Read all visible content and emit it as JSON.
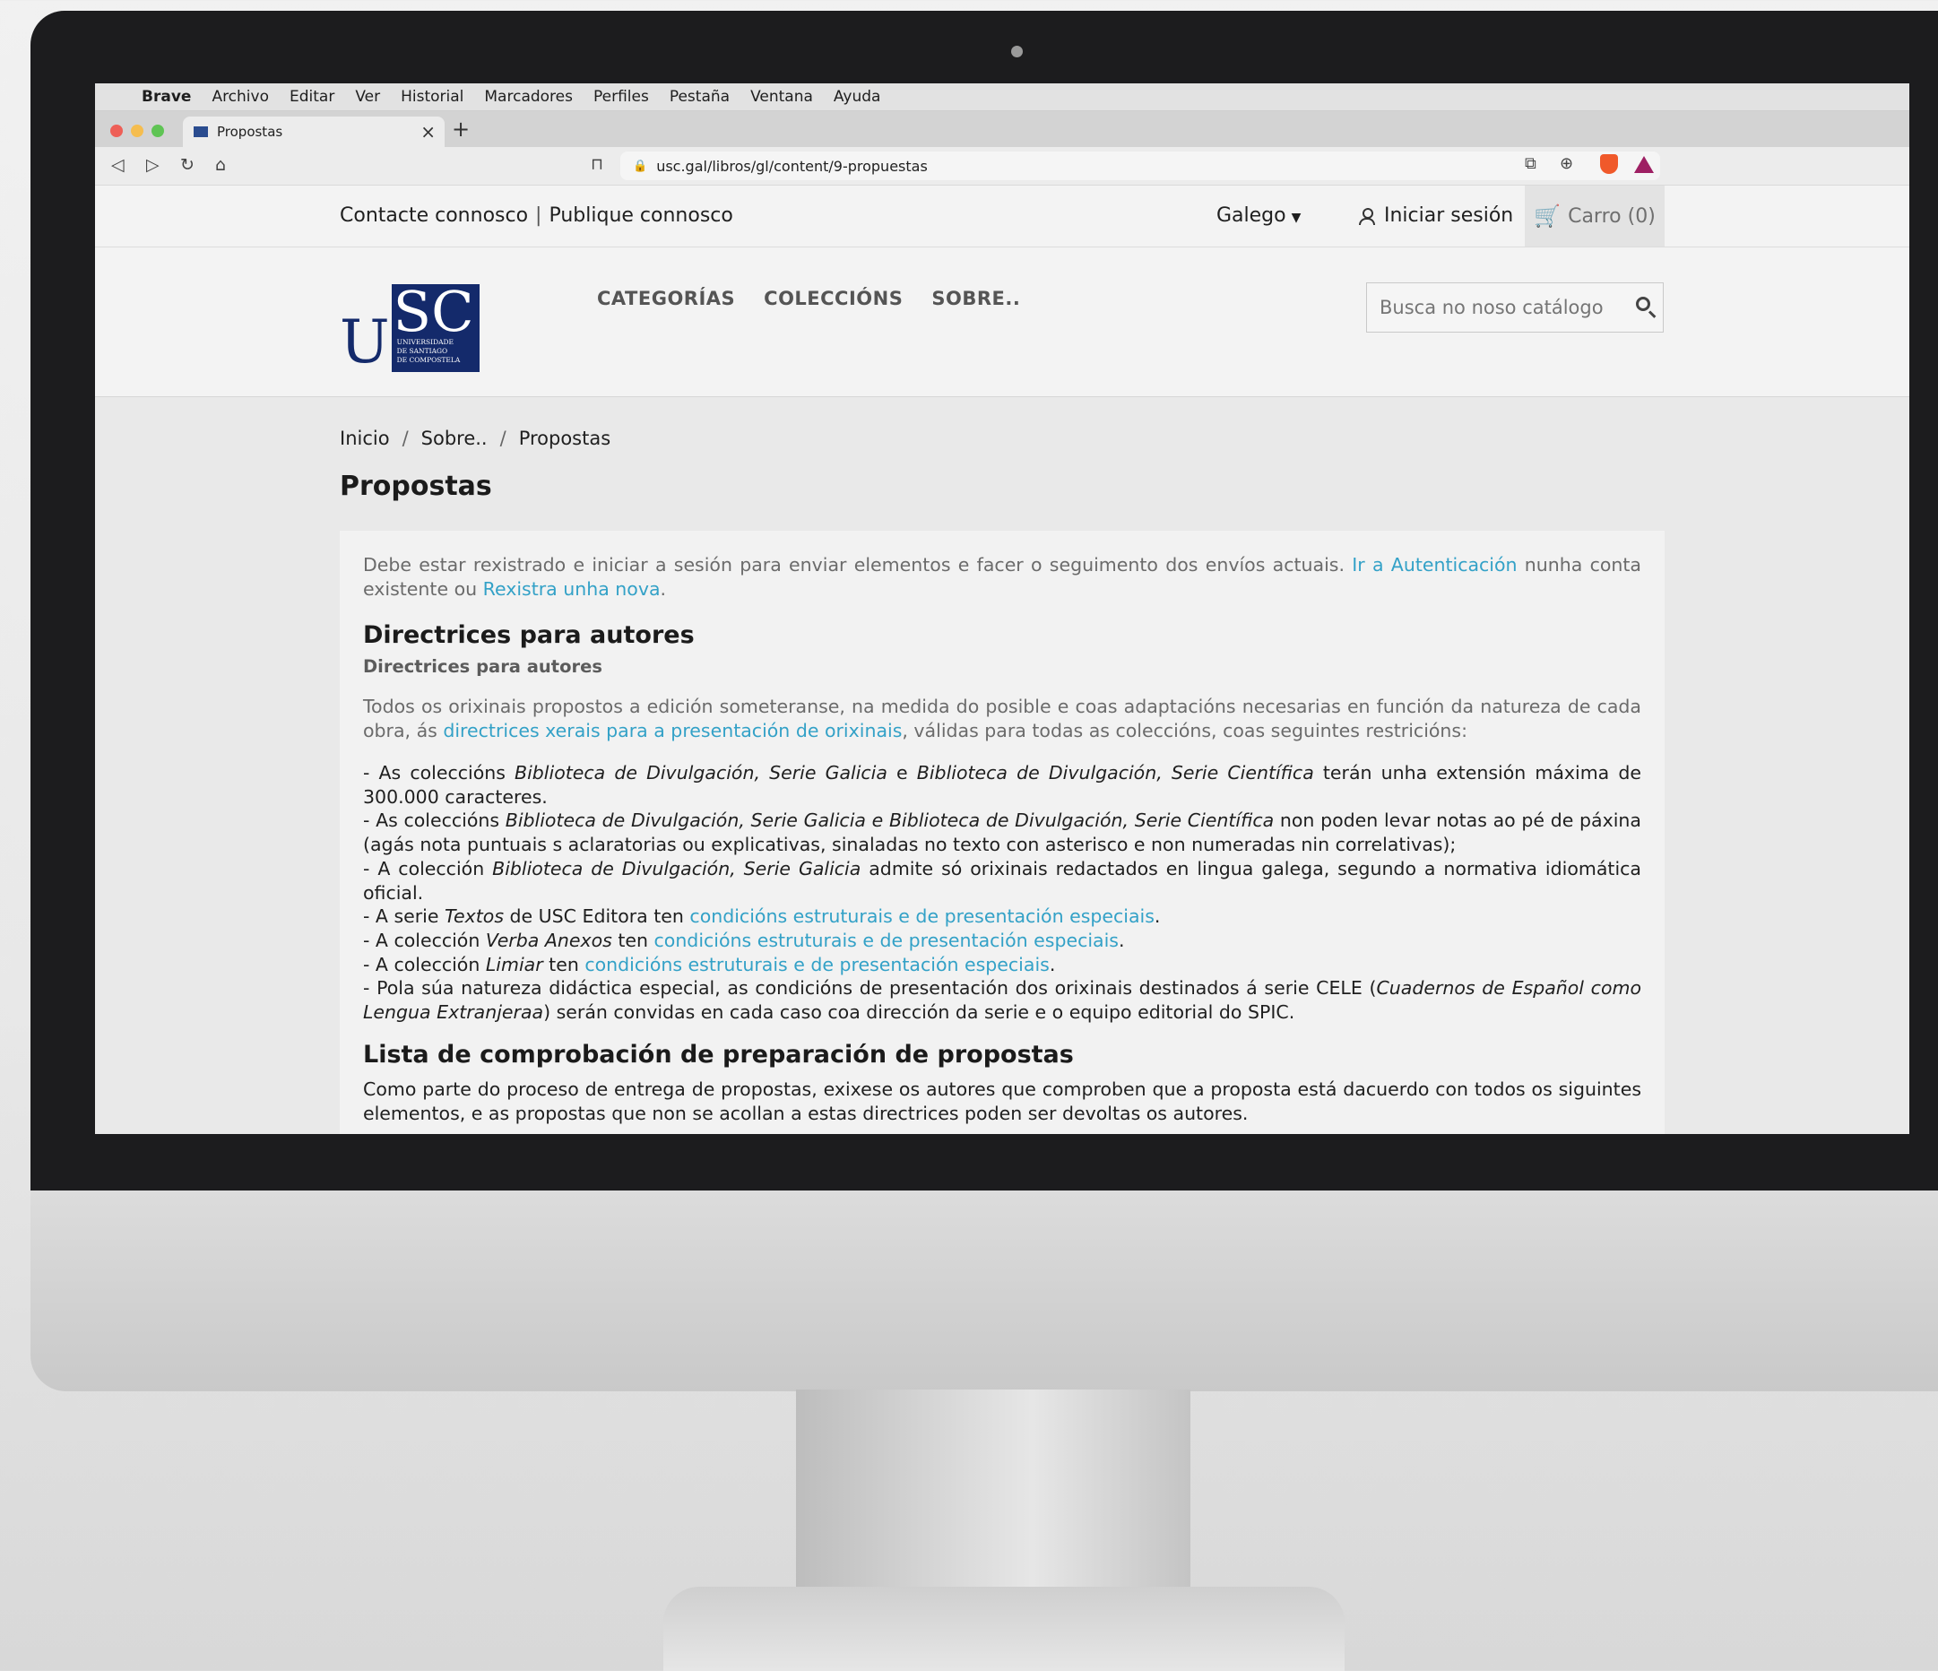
{
  "menubar": {
    "app": "Brave",
    "items": [
      "Archivo",
      "Editar",
      "Ver",
      "Historial",
      "Marcadores",
      "Perfiles",
      "Pestaña",
      "Ventana",
      "Ayuda"
    ]
  },
  "browser": {
    "tab_title": "Propostas",
    "url": "usc.gal/libros/gl/content/9-propuestas"
  },
  "site": {
    "top_links": [
      "Contacte connosco",
      "Publique connosco"
    ],
    "language": "Galego",
    "login": "Iniciar sesión",
    "cart": "Carro (0)",
    "logo": {
      "big": "U",
      "box": "SC",
      "small": [
        "UNIVERSIDADE",
        "DE SANTIAGO",
        "DE COMPOSTELA"
      ]
    },
    "nav": [
      "CATEGORÍAS",
      "COLECCIÓNS",
      "SOBRE.."
    ],
    "search_placeholder": "Busca no noso catálogo",
    "breadcrumb": [
      "Inicio",
      "Sobre..",
      "Propostas"
    ],
    "title": "Propostas"
  },
  "content": {
    "notice": {
      "before": "Debe estar rexistrado e iniciar a sesión para enviar elementos e facer o seguimento dos envíos actuais. ",
      "link1": "Ir a Autenticación",
      "middle": " nunha conta existente ou ",
      "link2": "Rexistra unha nova",
      "after": "."
    },
    "h2_guidelines": "Directrices para autores",
    "h3_guidelines": "Directrices para autores",
    "intro": {
      "before": "Todos os orixinais propostos a edición someteranse, na medida do posible e coas adaptacións necesarias en función da natureza de cada obra, ás ",
      "link": "directrices xerais para a presentación de orixinais",
      "after": ", válidas para todas as coleccións, coas seguintes restricións:"
    },
    "rules": {
      "r1": {
        "a": "- As coleccións ",
        "i1": "Biblioteca de Divulgación, Serie Galicia",
        "b": " e ",
        "i2": "Biblioteca de Divulgación, Serie Científica",
        "c": " terán unha extensión máxima de 300.000 caracteres."
      },
      "r2": {
        "a": "- As coleccións ",
        "i1": "Biblioteca de Divulgación, Serie Galicia e Biblioteca de Divulgación, Serie Científica",
        "b": " non poden levar notas ao pé de páxina (agás nota puntuais s aclaratorias ou explicativas, sinaladas no texto con asterisco e non numeradas nin correlativas);"
      },
      "r3": {
        "a": "- A colección ",
        "i1": "Biblioteca de Divulgación, Serie Galicia",
        "b": " admite só orixinais redactados en lingua galega, segundo a normativa idiomática oficial."
      },
      "r4": {
        "a": "- A serie ",
        "i1": "Textos",
        "b": " de USC Editora ten ",
        "link": "condicións estruturais e de presentación especiais",
        "c": "."
      },
      "r5": {
        "a": "- A colección ",
        "i1": "Verba Anexos",
        "b": " ten ",
        "link": "condicións estruturais e de presentación especiais",
        "c": "."
      },
      "r6": {
        "a": "- A colección ",
        "i1": "Limiar",
        "b": " ten ",
        "link": "condicións estruturais e de presentación especiais",
        "c": "."
      },
      "r7": {
        "a": "- Pola súa natureza didáctica especial,  as condicións de presentación dos orixinais destinados á serie CELE (",
        "i1": "Cuadernos de Español como Lengua Extranjeraa",
        "b": ") serán convidas en cada caso coa dirección da serie e o equipo  editorial do SPIC."
      }
    },
    "h2_checklist": "Lista de comprobación de preparación de propostas",
    "checklist_text": "Como parte do proceso de entrega de propostas, exixese os autores que comproben que a proposta está dacuerdo con todos os siguintes elementos, e as propostas que non se acollan a estas directrices poden ser devoltas os autores."
  }
}
